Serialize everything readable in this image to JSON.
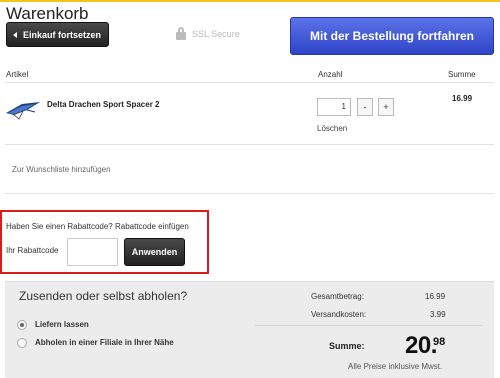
{
  "page": {
    "title": "Warenkorb"
  },
  "header": {
    "back_label": "Einkauf fortsetzen",
    "ssl_label": "SSL Secure",
    "checkout_label": "Mit der Bestellung fortfahren"
  },
  "table": {
    "headers": {
      "artikel": "Artikel",
      "anzahl": "Anzahl",
      "summe": "Summe"
    },
    "rows": [
      {
        "name": "Delta Drachen Sport Spacer 2",
        "quantity": "1",
        "minus": "-",
        "plus": "+",
        "remove": "Löschen",
        "price": "16.99"
      }
    ]
  },
  "wishlist_link": "Zur Wunschliste hinzufügen",
  "coupon": {
    "question": "Haben Sie einen Rabattcode? Rabattcode einfügen",
    "label": "Ihr Rabattcode",
    "input_value": "",
    "apply_label": "Anwenden"
  },
  "shipping": {
    "title": "Zusenden oder selbst abholen?",
    "options": [
      {
        "label": "Liefern lassen",
        "selected": true
      },
      {
        "label": "Abholen in einer Filiale in Ihrer Nähe",
        "selected": false
      }
    ]
  },
  "totals": {
    "subtotal_label": "Gesamtbetrag:",
    "subtotal_value": "16.99",
    "shipping_label": "Versandkosten:",
    "shipping_value": "3.99",
    "sum_label": "Summe:",
    "sum_main": "20.",
    "sum_cents": "98",
    "vat_note": "Alle Preise inklusive Mwst."
  },
  "colors": {
    "accent_blue": "#3b52d6",
    "highlight_red": "#e01a1a",
    "dark_button": "#2a2a2a"
  }
}
